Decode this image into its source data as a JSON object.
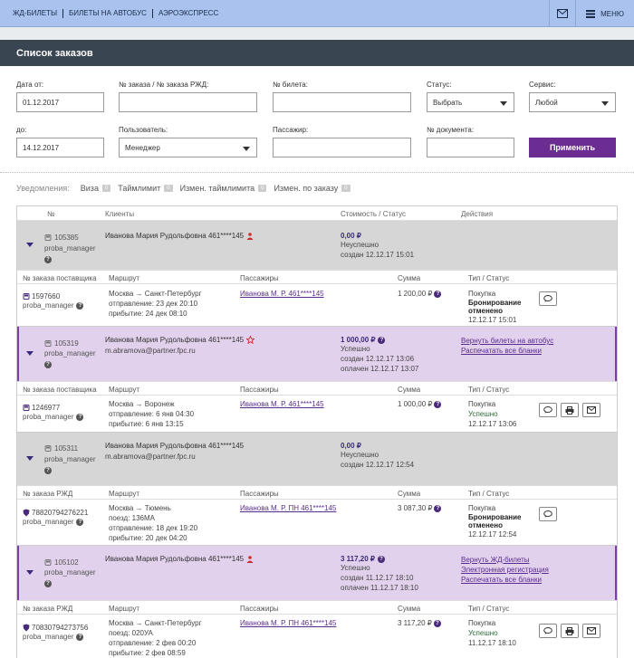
{
  "topnav": [
    "ЖД-БИЛЕТЫ",
    "БИЛЕТЫ НА АВТОБУС",
    "АЭРОЭКСПРЕСС"
  ],
  "menu_label": "МЕНЮ",
  "panel_title": "Список заказов",
  "filters": {
    "date_from_label": "Дата от:",
    "date_from": "01.12.2017",
    "order_label": "№ заказа / № заказа РЖД:",
    "ticket_label": "№ билета:",
    "status_label": "Статус:",
    "status_value": "Выбрать",
    "service_label": "Сервис:",
    "service_value": "Любой",
    "date_to_label": "до:",
    "date_to": "14.12.2017",
    "user_label": "Пользователь:",
    "user_value": "Менеджер",
    "passenger_label": "Пассажир:",
    "document_label": "№ документа:",
    "apply_label": "Применить"
  },
  "notifications": {
    "title": "Уведомления:",
    "items": [
      {
        "label": "Виза",
        "count": "0"
      },
      {
        "label": "Таймлимит",
        "count": "0"
      },
      {
        "label": "Измен. таймлимита",
        "count": "0"
      },
      {
        "label": "Измен. по заказу",
        "count": "0"
      }
    ]
  },
  "table_header": {
    "num": "№",
    "clients": "Клиенты",
    "cost": "Стоимость / Статус",
    "actions": "Действия"
  },
  "sub_header": {
    "route": "Маршрут",
    "passengers": "Пассажиры",
    "sum": "Сумма",
    "type": "Тип / Статус"
  },
  "orders": [
    {
      "id": "105385",
      "manager": "proba_manager",
      "client": "Иванова Мария Рудольфовна 461****145",
      "email": "",
      "price": "0,00 ₽",
      "status": "Неуспешно",
      "created": "создан 12.12.17 15:01",
      "paid": "",
      "actions": [],
      "sub_label": "№ заказа поставщика",
      "sub": {
        "num": "1597660",
        "manager": "proba_manager",
        "route": "Москва → Санкт-Петербург",
        "line2": "отправление: 23 дек 20:10",
        "line3": "прибытие: 24 дек 08:10",
        "passenger": "Иванова М. Р. 461****145",
        "sum": "1 200,00 ₽",
        "type": "Покупка",
        "status": "Бронирование отменено",
        "date": "12.12.17 15:01"
      }
    },
    {
      "id": "105319",
      "manager": "proba_manager",
      "client": "Иванова Мария Рудольфовна 461****145",
      "email": "m.abramova@partner.fpc.ru",
      "price": "1 000,00 ₽",
      "status": "Успешно",
      "created": "создан 12.12.17 13:06",
      "paid": "оплачен 12.12.17 13:07",
      "actions": [
        "Вернуть билеты на автобус",
        "Распечатать все бланки"
      ],
      "sub_label": "№ заказа поставщика",
      "sub": {
        "num": "1246977",
        "manager": "proba_manager",
        "route": "Москва → Воронеж",
        "line2": "отправление: 6 янв 04:30",
        "line3": "прибытие: 6 янв 13:15",
        "passenger": "Иванова М. Р. 461****145",
        "sum": "1 000,00 ₽",
        "type": "Покупка",
        "status": "Успешно",
        "date": "12.12.17 13:06"
      }
    },
    {
      "id": "105311",
      "manager": "proba_manager",
      "client": "Иванова Мария Рудольфовна 461****145",
      "email": "m.abramova@partner.fpc.ru",
      "price": "0,00 ₽",
      "status": "Неуспешно",
      "created": "создан 12.12.17 12:54",
      "paid": "",
      "actions": [],
      "sub_label": "№ заказа РЖД",
      "sub": {
        "num": "78820794276221",
        "manager": "proba_manager",
        "route": "Москва → Тюмень",
        "line2": "поезд: 136МА",
        "line3": "отправление: 18 дек 19:20",
        "line4": "прибытие: 20 дек 04:20",
        "passenger": "Иванова М. Р. ПН 461****145",
        "sum": "3 087,30 ₽",
        "type": "Покупка",
        "status": "Бронирование отменено",
        "date": "12.12.17 12:54"
      }
    },
    {
      "id": "105102",
      "manager": "proba_manager",
      "client": "Иванова Мария Рудольфовна 461****145",
      "email": "",
      "price": "3 117,20 ₽",
      "status": "Успешно",
      "created": "создан 11.12.17 18:10",
      "paid": "оплачен 11.12.17 18:10",
      "actions": [
        "Вернуть ЖД-билеты",
        "Электронная регистрация",
        "Распечатать все бланки"
      ],
      "sub_label": "№ заказа РЖД",
      "sub": {
        "num": "70830794273756",
        "manager": "proba_manager",
        "route": "Москва → Санкт-Петербург",
        "line2": "поезд: 020УА",
        "line3": "отправление: 2 фев 00:20",
        "line4": "прибытие: 2 фев 08:59",
        "passenger": "Иванова М. Р. ПН 461****145",
        "sum": "3 117,20 ₽",
        "type": "Покупка",
        "status": "Успешно",
        "date": "11.12.17 18:10"
      }
    }
  ]
}
